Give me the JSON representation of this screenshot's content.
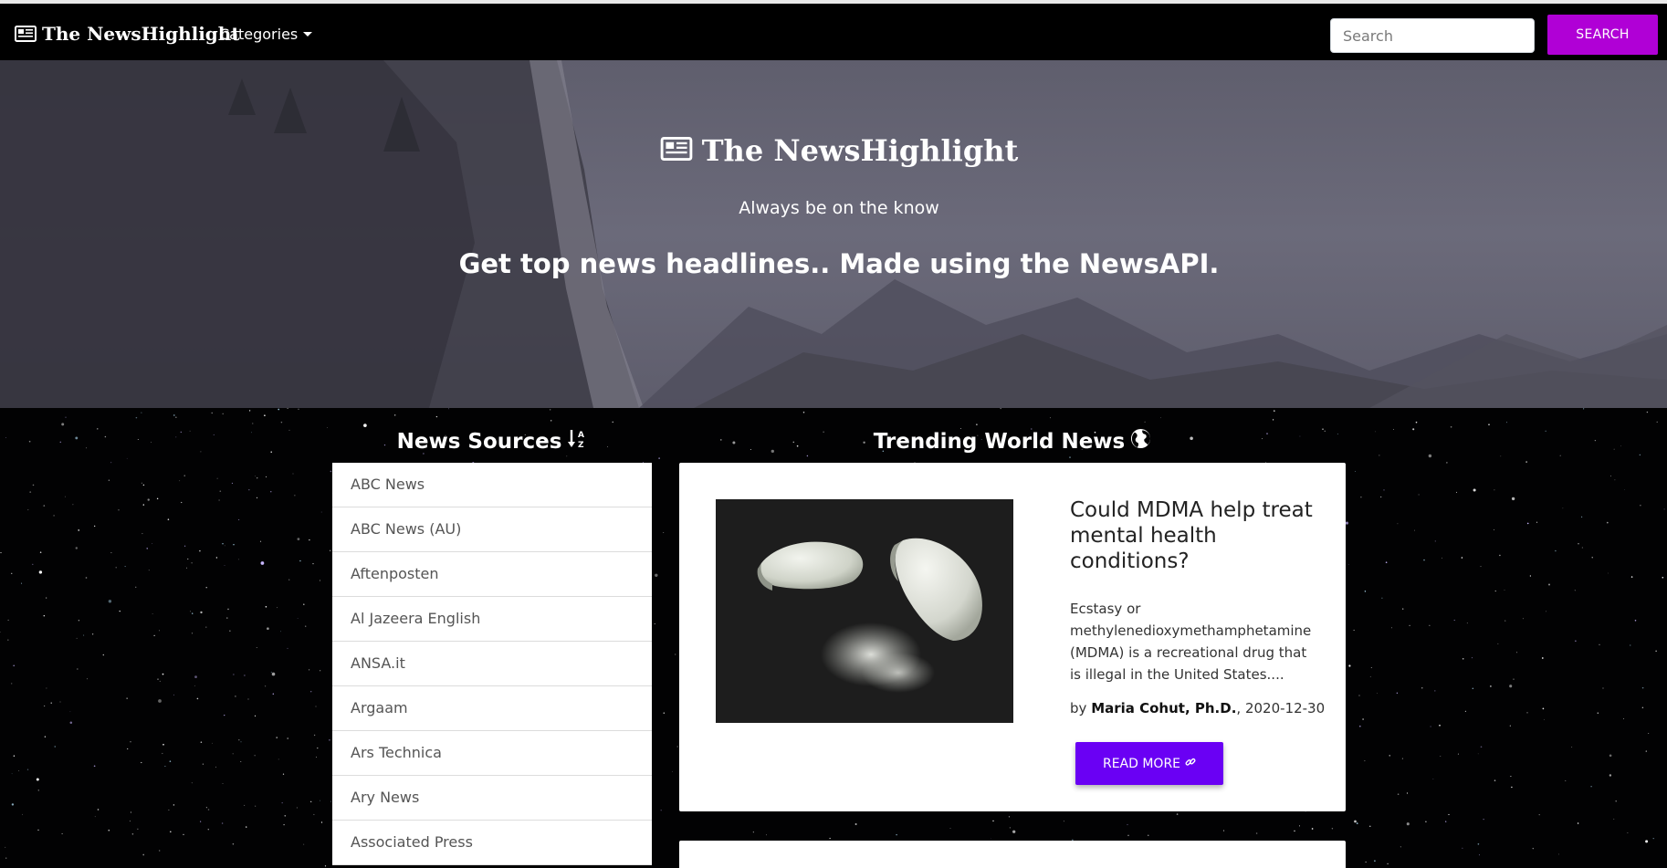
{
  "navbar": {
    "brand": "The NewsHighlight",
    "categories_label": "Categories",
    "search_placeholder": "Search",
    "search_button": "SEARCH"
  },
  "hero": {
    "title": "The NewsHighlight",
    "tagline": "Always be on the know",
    "subtitle": "Get top news headlines.. Made using the NewsAPI."
  },
  "sources": {
    "heading": "News Sources",
    "heading_icon": "sort-alpha-down-icon",
    "items": [
      "ABC News",
      "ABC News (AU)",
      "Aftenposten",
      "Al Jazeera English",
      "ANSA.it",
      "Argaam",
      "Ars Technica",
      "Ary News",
      "Associated Press"
    ]
  },
  "trending": {
    "heading": "Trending World News",
    "heading_icon": "globe-icon",
    "articles": [
      {
        "title": "Could MDMA help treat mental health conditions?",
        "description": "Ecstasy or methylenedioxymethamphetamine (MDMA) is a recreational drug that is illegal in the United States....",
        "by_prefix": "by",
        "author": "Maria Cohut, Ph.D.",
        "date_sep": ",",
        "date": "2020-12-30",
        "read_more": "READ MORE"
      }
    ]
  },
  "colors": {
    "search_button": "#b000d6",
    "read_more_button": "#6a00f4",
    "navbar": "#000000"
  }
}
